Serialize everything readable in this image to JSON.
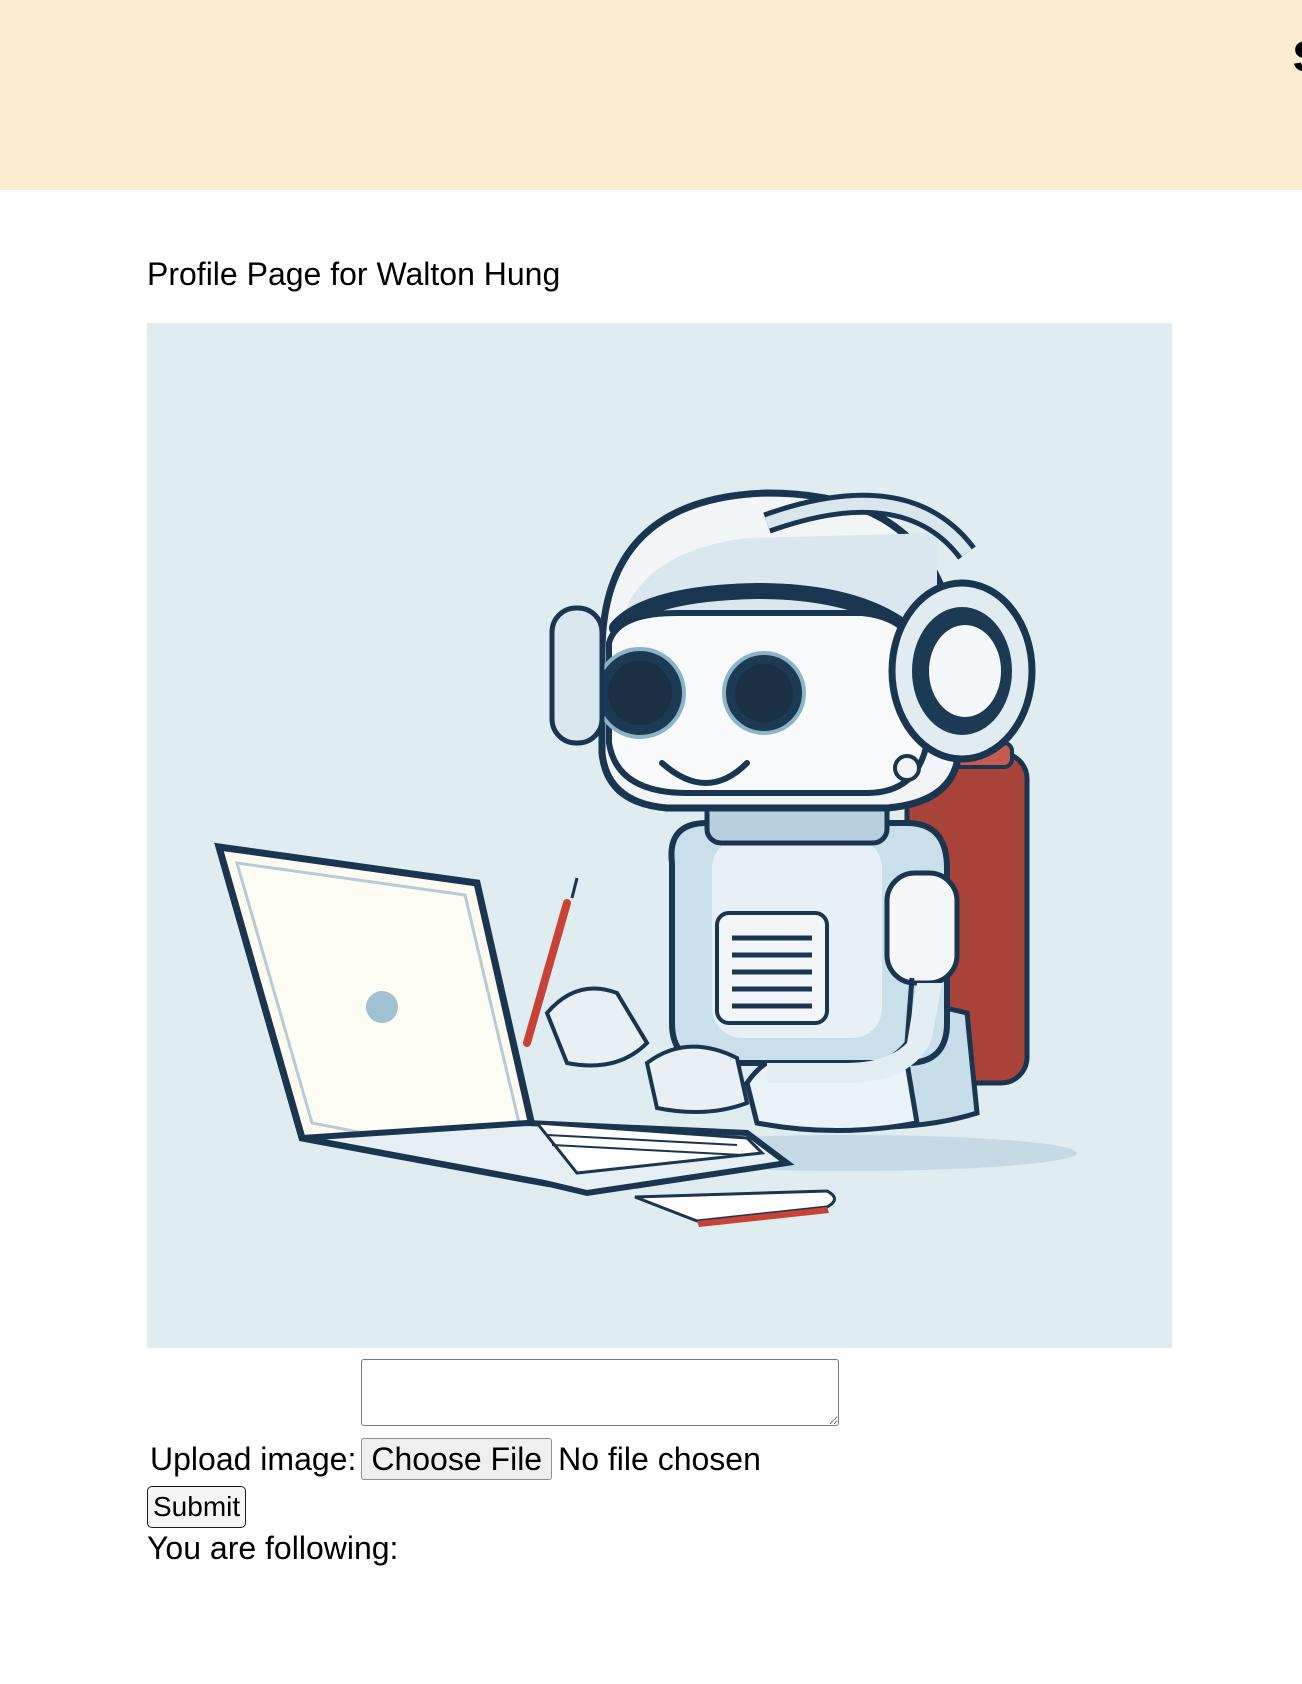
{
  "header": {
    "partial_letter": "s",
    "background_color": "#fcedd0"
  },
  "profile": {
    "title": "Profile Page for Walton Hung",
    "image_icon": "robot-with-laptop-illustration"
  },
  "form": {
    "bio_value": "",
    "upload_label": "Upload image:",
    "choose_file_label": "Choose File",
    "no_file_text": "No file chosen",
    "submit_label": "Submit"
  },
  "following": {
    "label": "You are following:"
  }
}
